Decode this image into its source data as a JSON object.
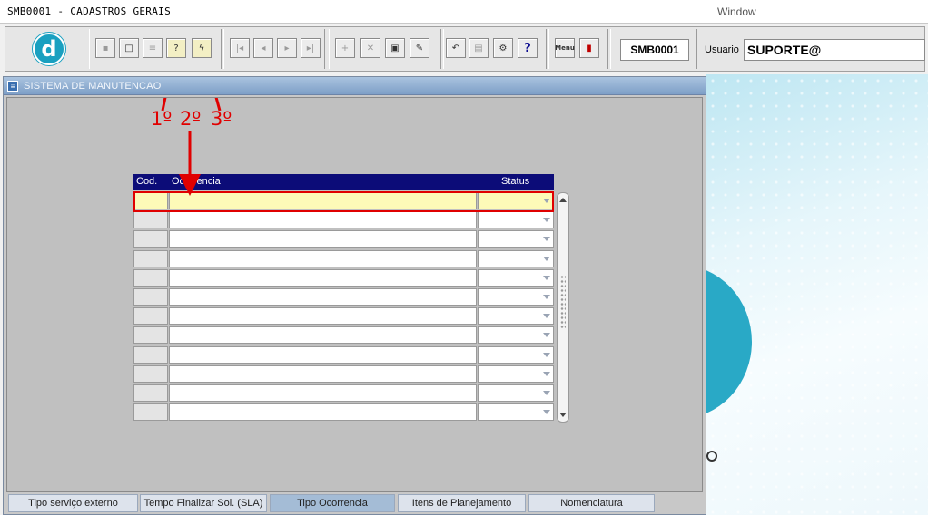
{
  "window": {
    "title": "SMB0001 - CADASTROS GERAIS",
    "menu_label": "Window"
  },
  "toolbar": {
    "logo_letter": "d",
    "report_label": "Menu",
    "form_code": "SMB0001",
    "user_label": "Usuario",
    "user_value": "SUPORTE@",
    "query_glyph": "?",
    "help_glyph": "?"
  },
  "form": {
    "title": "SISTEMA DE MANUTENCAO",
    "grid": {
      "columns": [
        "Cod.",
        "Ocorrencia",
        "Status"
      ],
      "rows": [
        {
          "cod": "",
          "ocorrencia": "",
          "status": ""
        },
        {
          "cod": "",
          "ocorrencia": "",
          "status": ""
        },
        {
          "cod": "",
          "ocorrencia": "",
          "status": ""
        },
        {
          "cod": "",
          "ocorrencia": "",
          "status": ""
        },
        {
          "cod": "",
          "ocorrencia": "",
          "status": ""
        },
        {
          "cod": "",
          "ocorrencia": "",
          "status": ""
        },
        {
          "cod": "",
          "ocorrencia": "",
          "status": ""
        },
        {
          "cod": "",
          "ocorrencia": "",
          "status": ""
        },
        {
          "cod": "",
          "ocorrencia": "",
          "status": ""
        },
        {
          "cod": "",
          "ocorrencia": "",
          "status": ""
        },
        {
          "cod": "",
          "ocorrencia": "",
          "status": ""
        },
        {
          "cod": "",
          "ocorrencia": "",
          "status": ""
        }
      ]
    }
  },
  "tabs": [
    {
      "label": "Tipo serviço externo"
    },
    {
      "label": "Tempo Finalizar Sol. (SLA)"
    },
    {
      "label": "Tipo Ocorrencia",
      "active": true
    },
    {
      "label": "Itens de Planejamento"
    },
    {
      "label": "Nomenclatura"
    }
  ],
  "annotations": [
    "1º",
    "2º",
    "3º"
  ],
  "colors": {
    "annotation": "#e00000",
    "header": "#0c0c78",
    "selected_row": "#fdfab8",
    "active_tab": "#a4bcd6"
  }
}
